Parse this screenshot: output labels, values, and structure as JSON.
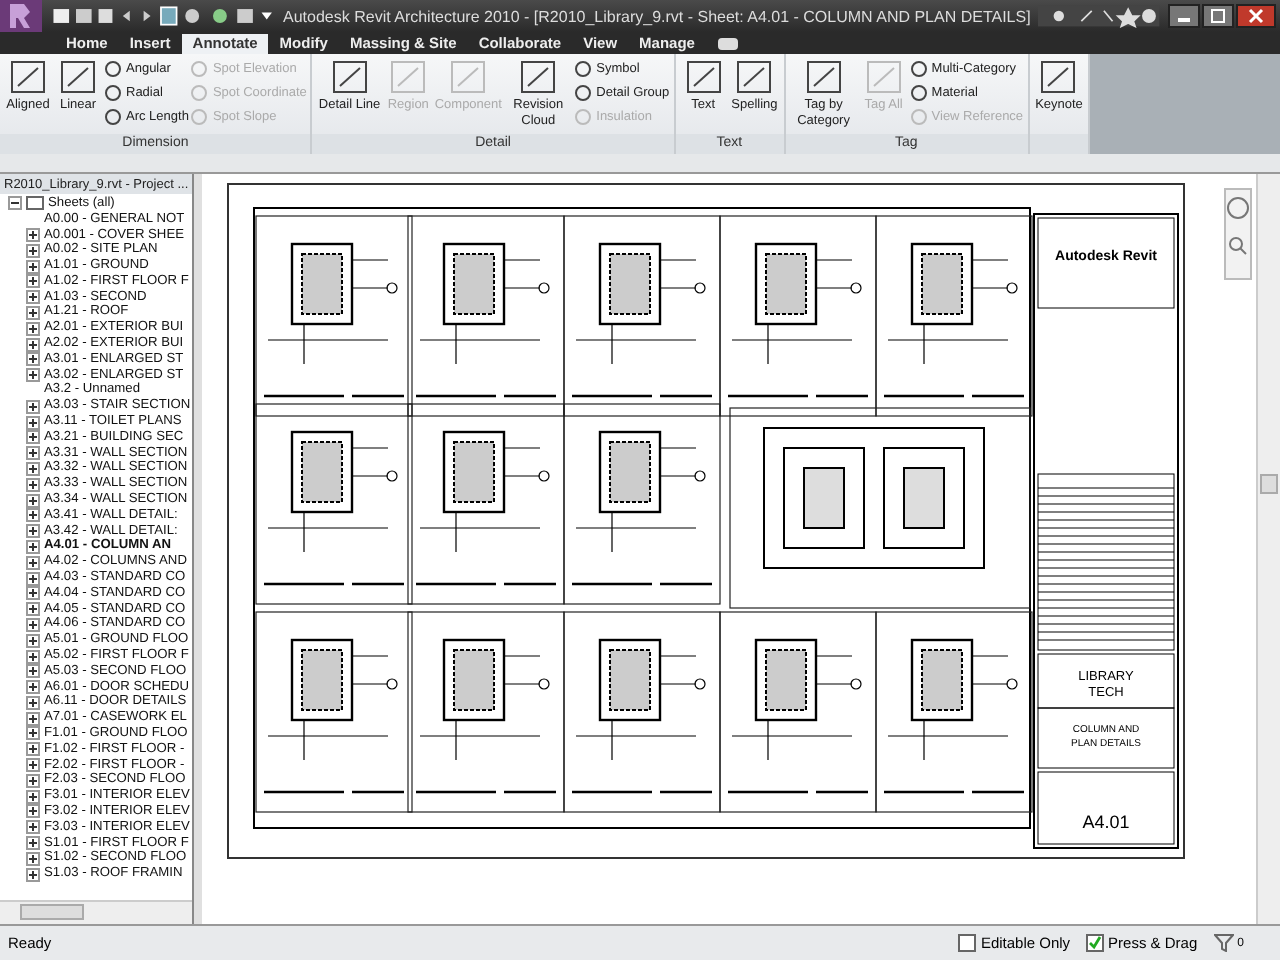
{
  "window": {
    "title": "Autodesk Revit Architecture 2010 - [R2010_Library_9.rvt - Sheet: A4.01 - COLUMN AND PLAN DETAILS]"
  },
  "tabs": [
    {
      "label": "Home",
      "selected": false
    },
    {
      "label": "Insert",
      "selected": false
    },
    {
      "label": "Annotate",
      "selected": true
    },
    {
      "label": "Modify",
      "selected": false
    },
    {
      "label": "Massing & Site",
      "selected": false
    },
    {
      "label": "Collaborate",
      "selected": false
    },
    {
      "label": "View",
      "selected": false
    },
    {
      "label": "Manage",
      "selected": false
    }
  ],
  "ribbon": [
    {
      "label": "Dimension",
      "groups": [
        {
          "kind": "large",
          "items": [
            {
              "label": "Aligned",
              "disabled": false
            }
          ]
        },
        {
          "kind": "large",
          "items": [
            {
              "label": "Linear",
              "disabled": false
            }
          ]
        },
        {
          "kind": "small",
          "items": [
            {
              "label": "Angular",
              "disabled": false
            },
            {
              "label": "Radial",
              "disabled": false
            },
            {
              "label": "Arc Length",
              "disabled": false
            }
          ]
        },
        {
          "kind": "small",
          "items": [
            {
              "label": "Spot Elevation",
              "disabled": true
            },
            {
              "label": "Spot Coordinate",
              "disabled": true
            },
            {
              "label": "Spot Slope",
              "disabled": true
            }
          ]
        }
      ]
    },
    {
      "label": "Detail",
      "groups": [
        {
          "kind": "large",
          "items": [
            {
              "label": "Detail Line",
              "disabled": false
            }
          ]
        },
        {
          "kind": "large",
          "items": [
            {
              "label": "Region",
              "disabled": true
            }
          ]
        },
        {
          "kind": "large",
          "items": [
            {
              "label": "Component",
              "disabled": true
            }
          ]
        },
        {
          "kind": "large",
          "items": [
            {
              "label": "Revision Cloud",
              "disabled": false
            }
          ]
        },
        {
          "kind": "small",
          "items": [
            {
              "label": "Symbol",
              "disabled": false
            },
            {
              "label": "Detail Group",
              "disabled": false
            },
            {
              "label": "Insulation",
              "disabled": true
            }
          ]
        }
      ]
    },
    {
      "label": "Text",
      "groups": [
        {
          "kind": "large",
          "items": [
            {
              "label": "Text",
              "disabled": false
            }
          ]
        },
        {
          "kind": "large",
          "items": [
            {
              "label": "Spelling",
              "disabled": false
            }
          ]
        }
      ]
    },
    {
      "label": "Tag",
      "groups": [
        {
          "kind": "large",
          "items": [
            {
              "label": "Tag by Category",
              "disabled": false
            }
          ]
        },
        {
          "kind": "large",
          "items": [
            {
              "label": "Tag All",
              "disabled": true
            }
          ]
        },
        {
          "kind": "small",
          "items": [
            {
              "label": "Multi-Category",
              "disabled": false
            },
            {
              "label": "Material",
              "disabled": false
            },
            {
              "label": "View Reference",
              "disabled": true
            }
          ]
        }
      ]
    },
    {
      "groups": [
        {
          "kind": "large",
          "items": [
            {
              "label": "Keynote",
              "disabled": false
            }
          ]
        }
      ]
    }
  ],
  "project_browser": {
    "title": "R2010_Library_9.rvt - Project ...",
    "tree": [
      {
        "label": "Sheets (all)",
        "expanded": true,
        "selected": false,
        "children": [
          {
            "label": "A0.00 - GENERAL NOT",
            "expandable": false,
            "selected": false
          },
          {
            "label": "A0.001 - COVER SHEE",
            "expandable": true,
            "selected": false
          },
          {
            "label": "A0.02 - SITE PLAN",
            "expandable": true,
            "selected": false
          },
          {
            "label": "A1.01 - GROUND",
            "expandable": true,
            "selected": false
          },
          {
            "label": "A1.02 - FIRST FLOOR F",
            "expandable": true,
            "selected": false
          },
          {
            "label": "A1.03 - SECOND",
            "expandable": true,
            "selected": false
          },
          {
            "label": "A1.21 - ROOF",
            "expandable": true,
            "selected": false
          },
          {
            "label": "A2.01 - EXTERIOR BUI",
            "expandable": true,
            "selected": false
          },
          {
            "label": "A2.02 - EXTERIOR BUI",
            "expandable": true,
            "selected": false
          },
          {
            "label": "A3.01 - ENLARGED ST",
            "expandable": true,
            "selected": false
          },
          {
            "label": "A3.02 - ENLARGED ST",
            "expandable": true,
            "selected": false
          },
          {
            "label": "A3.2 - Unnamed",
            "expandable": false,
            "selected": false
          },
          {
            "label": "A3.03 - STAIR SECTION",
            "expandable": true,
            "selected": false
          },
          {
            "label": "A3.11 - TOILET PLANS",
            "expandable": true,
            "selected": false
          },
          {
            "label": "A3.21 - BUILDING SEC",
            "expandable": true,
            "selected": false
          },
          {
            "label": "A3.31 - WALL SECTION",
            "expandable": true,
            "selected": false
          },
          {
            "label": "A3.32 - WALL SECTION",
            "expandable": true,
            "selected": false
          },
          {
            "label": "A3.33 - WALL SECTION",
            "expandable": true,
            "selected": false
          },
          {
            "label": "A3.34 - WALL SECTION",
            "expandable": true,
            "selected": false
          },
          {
            "label": "A3.41 - WALL DETAIL:",
            "expandable": true,
            "selected": false
          },
          {
            "label": "A3.42 - WALL DETAIL:",
            "expandable": true,
            "selected": false
          },
          {
            "label": "A4.01 - COLUMN AN",
            "expandable": true,
            "selected": true
          },
          {
            "label": "A4.02 - COLUMNS AND",
            "expandable": true,
            "selected": false
          },
          {
            "label": "A4.03 - STANDARD CO",
            "expandable": true,
            "selected": false
          },
          {
            "label": "A4.04 - STANDARD CO",
            "expandable": true,
            "selected": false
          },
          {
            "label": "A4.05 - STANDARD CO",
            "expandable": true,
            "selected": false
          },
          {
            "label": "A4.06 - STANDARD CO",
            "expandable": true,
            "selected": false
          },
          {
            "label": "A5.01 - GROUND FLOO",
            "expandable": true,
            "selected": false
          },
          {
            "label": "A5.02 - FIRST FLOOR F",
            "expandable": true,
            "selected": false
          },
          {
            "label": "A5.03 - SECOND FLOO",
            "expandable": true,
            "selected": false
          },
          {
            "label": "A6.01 - DOOR SCHEDU",
            "expandable": true,
            "selected": false
          },
          {
            "label": "A6.11 - DOOR DETAILS",
            "expandable": true,
            "selected": false
          },
          {
            "label": "A7.01 - CASEWORK EL",
            "expandable": true,
            "selected": false
          },
          {
            "label": "F1.01 - GROUND FLOO",
            "expandable": true,
            "selected": false
          },
          {
            "label": "F1.02 - FIRST FLOOR -",
            "expandable": true,
            "selected": false
          },
          {
            "label": "F2.02 - FIRST FLOOR -",
            "expandable": true,
            "selected": false
          },
          {
            "label": "F2.03 - SECOND FLOO",
            "expandable": true,
            "selected": false
          },
          {
            "label": "F3.01 - INTERIOR ELEV",
            "expandable": true,
            "selected": false
          },
          {
            "label": "F3.02 - INTERIOR ELEV",
            "expandable": true,
            "selected": false
          },
          {
            "label": "F3.03 - INTERIOR ELEV",
            "expandable": true,
            "selected": false
          },
          {
            "label": "S1.01 - FIRST FLOOR F",
            "expandable": true,
            "selected": false
          },
          {
            "label": "S1.02 - SECOND FLOO",
            "expandable": true,
            "selected": false
          },
          {
            "label": "S1.03 - ROOF FRAMIN",
            "expandable": true,
            "selected": false
          }
        ]
      }
    ]
  },
  "sheet": {
    "company": "Autodesk Revit",
    "project": "LIBRARY TECH",
    "sheet_name": "COLUMN AND PLAN DETAILS",
    "sheet_number": "A4.01"
  },
  "status_bar": {
    "text": "Ready",
    "options": [
      {
        "label": "Editable Only",
        "checked": false
      },
      {
        "label": "Press & Drag",
        "checked": true
      }
    ],
    "filter_count": "0"
  }
}
